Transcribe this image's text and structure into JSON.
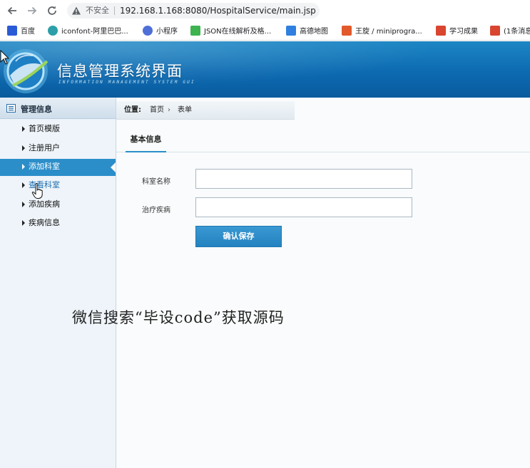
{
  "browser": {
    "security_label": "不安全",
    "url": "192.168.1.168:8080/HospitalService/main.jsp",
    "bookmarks": [
      {
        "label": "百度",
        "color": "#2a5bd6"
      },
      {
        "label": "iconfont-阿里巴巴...",
        "color": "#2c9fa9"
      },
      {
        "label": "小程序",
        "color": "#4f6fd8"
      },
      {
        "label": "JSON在线解析及格...",
        "color": "#3eb34f"
      },
      {
        "label": "高德地图",
        "color": "#2f7fe0"
      },
      {
        "label": "王旋 / miniprogra...",
        "color": "#e2592b"
      },
      {
        "label": "学习成果",
        "color": "#d9452f"
      },
      {
        "label": "(1条消息",
        "color": "#d9452f"
      }
    ]
  },
  "header": {
    "title": "信息管理系统界面",
    "subtitle": "INFORMATION MANAGEMENT SYSTEM GUI"
  },
  "sidebar": {
    "heading": "管理信息",
    "items": [
      {
        "label": "首页模版"
      },
      {
        "label": "注册用户"
      },
      {
        "label": "添加科室"
      },
      {
        "label": "查看科室"
      },
      {
        "label": "添加疾病"
      },
      {
        "label": "疾病信息"
      }
    ]
  },
  "breadcrumb": {
    "prefix": "位置:",
    "home": "首页",
    "separator": "›",
    "current": "表单"
  },
  "form": {
    "tab_label": "基本信息",
    "dept_name_label": "科室名称",
    "dept_name_value": "",
    "treat_disease_label": "治疗疾病",
    "treat_disease_value": "",
    "save_label": "确认保存"
  },
  "overlay_text": "微信搜索“毕设code”获取源码"
}
